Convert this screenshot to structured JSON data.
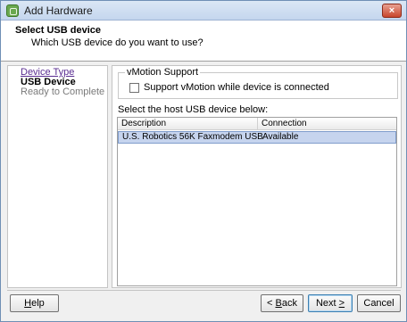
{
  "window": {
    "title": "Add Hardware",
    "close_symbol": "×"
  },
  "header": {
    "title": "Select USB device",
    "subtitle": "Which USB device do you want to use?"
  },
  "nav": {
    "items": [
      {
        "label": "Device Type",
        "state": "link"
      },
      {
        "label": "USB Device",
        "state": "current"
      },
      {
        "label": "Ready to Complete",
        "state": "pending"
      }
    ]
  },
  "vmotion": {
    "legend": "vMotion Support",
    "checkbox_label": "Support vMotion while device is connected",
    "checked": false
  },
  "device_list": {
    "prompt": "Select the host USB device below:",
    "columns": [
      "Description",
      "Connection"
    ],
    "rows": [
      {
        "description": "U.S. Robotics 56K Faxmodem USB",
        "connection": "Available",
        "selected": true
      }
    ]
  },
  "buttons": {
    "help": {
      "first": "H",
      "rest": "elp"
    },
    "back": {
      "first": "< ",
      "mnemonic": "B",
      "rest": "ack"
    },
    "next": {
      "first": "Next ",
      "mnemonic": ">",
      "rest": ""
    },
    "cancel": "Cancel"
  },
  "colors": {
    "selection": "#c6d4ee",
    "link": "#5a2d91",
    "close_button": "#c8452c"
  }
}
